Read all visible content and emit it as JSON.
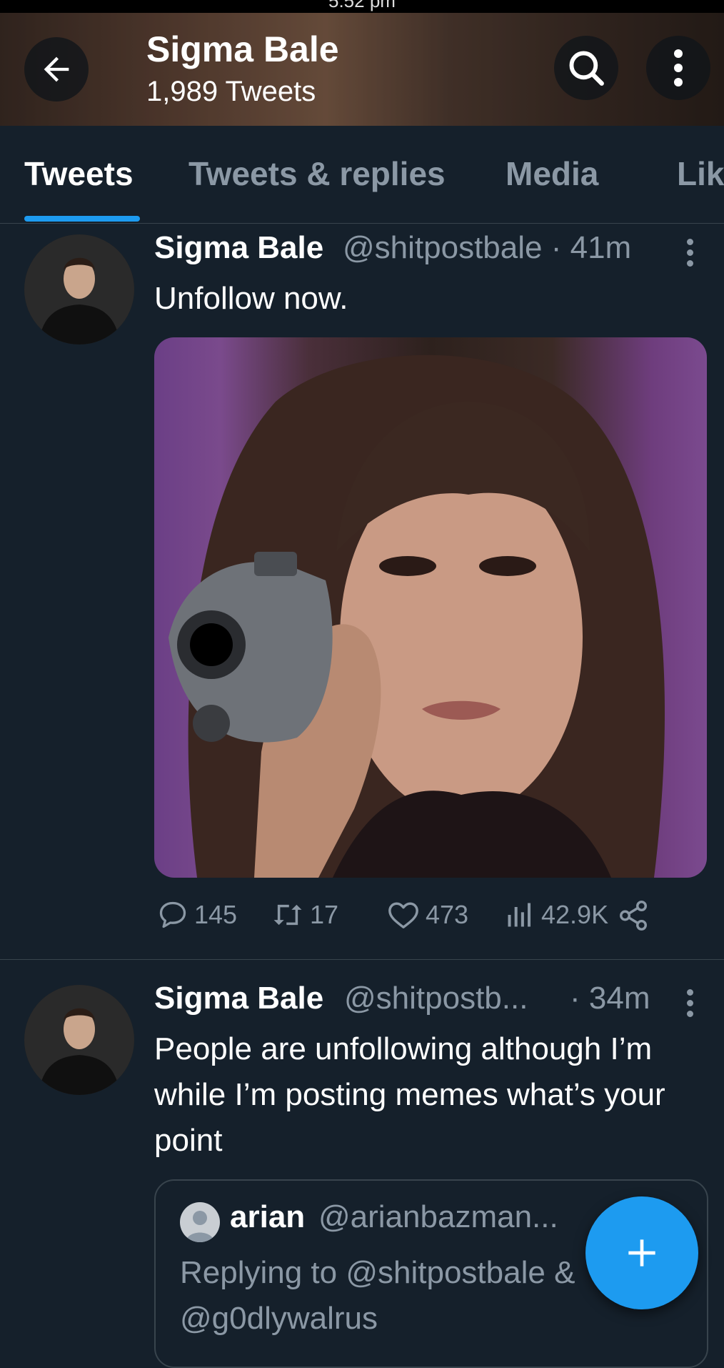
{
  "status_bar": {
    "time": "5:52 pm"
  },
  "header": {
    "name": "Sigma Bale",
    "tweet_count": "1,989 Tweets"
  },
  "tabs": [
    {
      "label": "Tweets"
    },
    {
      "label": "Tweets & replies"
    },
    {
      "label": "Media"
    },
    {
      "label": "Lik"
    }
  ],
  "tweets": [
    {
      "name": "Sigma Bale",
      "meta": "@shitpostbale · 41m",
      "text": "Unfollow now.",
      "stats": {
        "replies": "145",
        "retweets": "17",
        "likes": "473",
        "views": "42.9K"
      }
    },
    {
      "name": "Sigma Bale",
      "meta": "@shitpostb...",
      "time": "· 34m",
      "text": "People are unfollowing although I’m while I’m posting memes what’s your point",
      "quote": {
        "name": "arian",
        "handle": "@arianbazman...",
        "reply_line": "Replying to @shitpostbale &",
        "reply_line2": "@g0dlywalrus"
      }
    }
  ],
  "colors": {
    "background": "#15202b",
    "accent": "#1d9bf0",
    "muted": "#8b98a5"
  }
}
